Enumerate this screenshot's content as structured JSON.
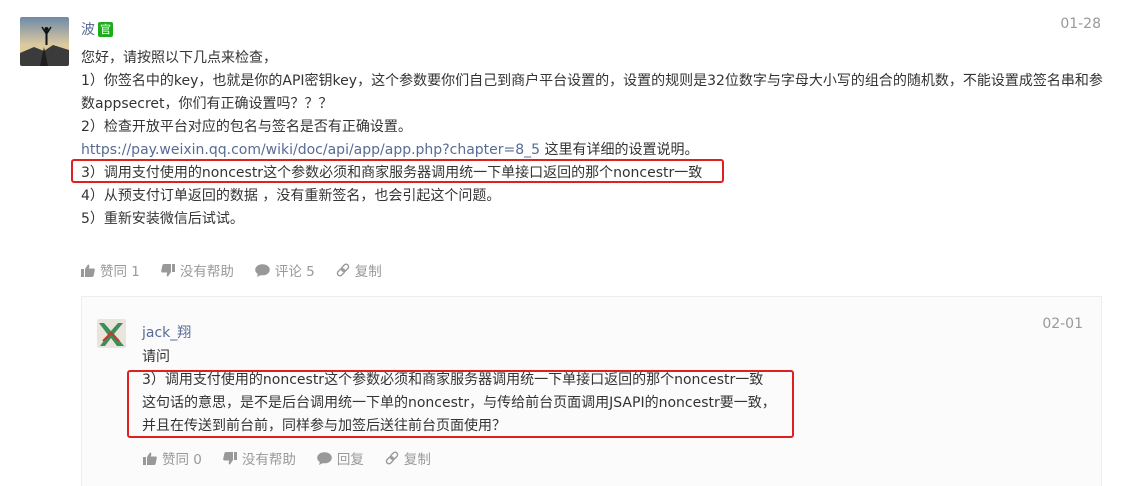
{
  "post": {
    "author": "波",
    "badge": "官",
    "date": "01-28",
    "lines": [
      "您好，请按照以下几点来检查，",
      "1）你签名中的key，也就是你的API密钥key，这个参数要你们自己到商户平台设置的，设置的规则是32位数字与字母大小写的组合的随机数，不能设置成签名串和参数appsecret，你们有正确设置吗？？？",
      "2）检查开放平台对应的包名与签名是否有正确设置。",
      "3）调用支付使用的noncestr这个参数必须和商家服务器调用统一下单接口返回的那个noncestr一致",
      "4）从预支付订单返回的数据 ，没有重新签名，也会引起这个问题。",
      "5）重新安装微信后试试。"
    ],
    "link": {
      "url_text": "https://pay.weixin.qq.com/wiki/doc/api/app/app.php?chapter=8_5",
      "suffix": " 这里有详细的设置说明。"
    },
    "actions": {
      "like": "赞同 1",
      "unhelpful": "没有帮助",
      "comment": "评论 5",
      "copy": "复制"
    }
  },
  "reply": {
    "author": "jack_翔",
    "date": "02-01",
    "lines": [
      "请问",
      "3）调用支付使用的noncestr这个参数必须和商家服务器调用统一下单接口返回的那个noncestr一致",
      "这句话的意思，是不是后台调用统一下单的noncestr，与传给前台页面调用JSAPI的noncestr要一致，",
      "并且在传送到前台前，同样参与加签后送往前台页面使用？"
    ],
    "actions": {
      "like": "赞同 0",
      "unhelpful": "没有帮助",
      "reply": "回复",
      "copy": "复制"
    }
  },
  "colors": {
    "link": "#576b95",
    "badge": "#1aad19",
    "highlight": "#e02020",
    "muted": "#999999",
    "text": "#333333"
  },
  "icons": [
    "thumb-up-icon",
    "thumb-down-icon",
    "comment-bubble-icon",
    "link-chain-icon",
    "reply-icon"
  ]
}
